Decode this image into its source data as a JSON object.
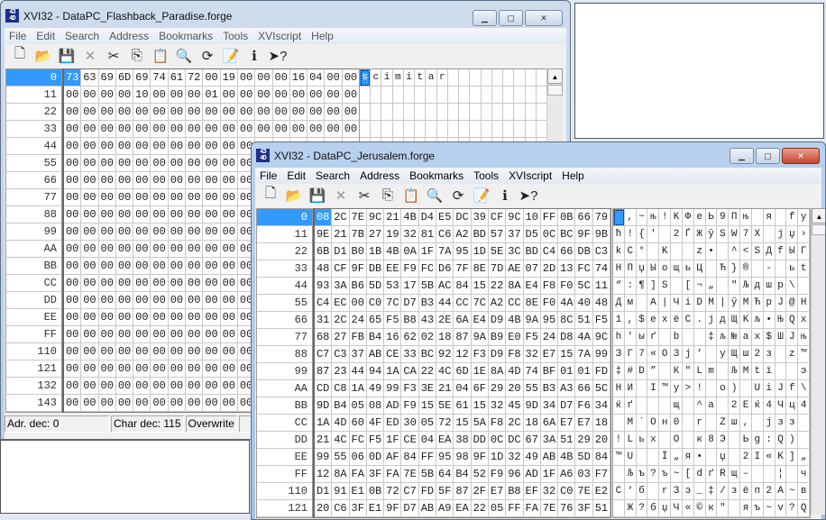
{
  "back_window": {
    "title": "XVI32 - DataPC_Flashback_Paradise.forge",
    "menu": [
      "File",
      "Edit",
      "Search",
      "Address",
      "Bookmarks",
      "Tools",
      "XVIscript",
      "Help"
    ],
    "addresses": [
      "0",
      "11",
      "22",
      "33",
      "44",
      "55",
      "66",
      "77",
      "88",
      "99",
      "AA",
      "BB",
      "CC",
      "DD",
      "EE",
      "FF",
      "110",
      "121",
      "132",
      "143"
    ],
    "hex_rows": [
      "73 63 69 6D 69 74 61 72 00 19 00 00 00 16 04 00 00",
      "00 00 00 00 10 00 00 00 01 00 00 00 00 00 00 00 00",
      "00 00 00 00 00 00 00 00 00 00 00 00 00 00 00 00 00",
      "00 00 00 00 00 00 00 00 00 00 00 00 00 00 00 00 00",
      "00 00 00 00 00 00 00 00 00 00 00 00 00 00 00 00 00",
      "00 00 00 00 00 00 00 00 00 00 00 00 00 00 00 00 00",
      "00 00 00 00 00 00 00 00 00 00 00 00 00 00 00 00 00",
      "00 00 00 00 00 00 00 00 00 00 00 00 00 00 00 00 00",
      "00 00 00 00 00 00 00 00 00 00 00 00 00 00 00 00 00",
      "00 00 00 00 00 00 00 00 00 00 00 00 00 00 00 00 00",
      "00 00 00 00 00 00 00 00 00 00 00 00 00 00 00 00 00",
      "00 00 00 00 00 00 00 00 00 00 00 00 00 00 00 00 00",
      "00 00 00 00 00 00 00 00 00 00 00 00 00 00 00 00 00",
      "00 00 00 00 00 00 00 00 00 00 00 00 00 00 00 00 00",
      "00 00 00 00 00 00 00 00 00 00 00 00 00 00 00 00 00",
      "00 00 00 00 00 00 00 00 00 00 00 00 00 00 00 00 00",
      "00 00 00 00 00 00 00 00 00 00 00 00 00 00 00 00 00",
      "00 00 00 00 00 00 00 00 00 00 00 00 00 00 00 00 00",
      "00 00 00 00 00 00 00 00 00 00 00 00 00 00 00 00 00",
      "00 00 00 00 00 00 00 00 00 00 00 00 00 00 00 00 00"
    ],
    "status": {
      "address": "Adr. dec: 0",
      "char": "Char dec: 115",
      "mode": "Overwrite"
    }
  },
  "front_window": {
    "title": "XVI32 - DataPC_Jerusalem.forge",
    "menu": [
      "File",
      "Edit",
      "Search",
      "Address",
      "Bookmarks",
      "Tools",
      "XVIscript",
      "Help"
    ],
    "addresses": [
      "0",
      "11",
      "22",
      "33",
      "44",
      "55",
      "66",
      "77",
      "88",
      "99",
      "AA",
      "BB",
      "CC",
      "DD",
      "EE",
      "FF",
      "110",
      "121"
    ],
    "hex_rows": [
      "08 2C 7E 9C 21 4B D4 E5 DC 39 CF 9C 10 FF 0B 66 79",
      "9E 21 7B 27 19 32 81 C6 A2 BD 57 37 D5 0C BC 9F 9B",
      "6B D1 B0 1B 4B 0A 1F 7A 95 1D 5E 3C BD C4 66 DB C3",
      "48 CF 9F DB EE F9 FC D6 7F 8E 7D AE 07 2D 13 FC 74",
      "93 3A B6 5D 53 17 5B AC 84 15 22 8A E4 F8 F0 5C 11",
      "C4 EC 00 C0 7C D7 B3 44 CC 7C A2 CC 8E F0 4A 40 48",
      "31 2C 24 65 F5 B8 43 2E 6A E4 D9 4B 9A 95 8C 51 F5",
      "68 27 FB B4 16 62 02 18 87 9A B9 E0 F5 24 D8 4A 9C",
      "C7 C3 37 AB CE 33 BC 92 12 F3 D9 F8 32 E7 15 7A 99",
      "87 23 44 94 1A CA 22 4C 6D 1E 8A 4D 74 BF 01 01 FD",
      "CD C8 1A 49 99 F3 3E 21 04 6F 29 20 55 B3 A3 66 5C",
      "9D B4 05 08 AD F9 15 5E 61 15 32 45 9D 34 D7 F6 34",
      "1A 4D 60 4F ED 30 05 72 15 5A F8 2C 18 6A E7 E7 18",
      "21 4C FC F5 1F CE 04 EA 38 DD 0C DC 67 3A 51 29 20",
      "99 55 06 0D AF 84 FF 95 98 9F 1D 32 49 AB 4B 5D 84",
      "12 8A FA 3F FA 7E 5B 64 B4 52 F9 96 AD 1F A6 03 F7",
      "D1 91 E1 0B 72 C7 FD 5F 87 2F E7 B8 EF 32 C0 7E E2",
      "20 C6 3F E1 9F D7 AB A9 EA 22 05 FF FA 7E 76 3F 51"
    ]
  },
  "toolbar_icons": [
    "new-file-icon",
    "open-folder-icon",
    "save-icon",
    "delete-icon",
    "cut-icon",
    "copy-icon",
    "paste-icon",
    "find-icon",
    "replace-icon",
    "properties-icon",
    "info-icon",
    "context-help-icon"
  ],
  "colors": {
    "selection": "#3399ff"
  }
}
